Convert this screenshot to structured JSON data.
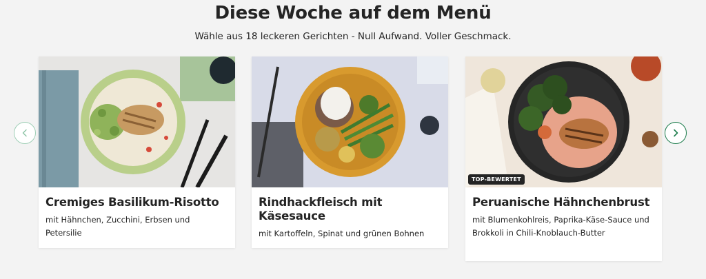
{
  "section": {
    "title": "Diese Woche auf dem Menü",
    "subtitle": "Wähle aus 18 leckeren Gerichten - Null Aufwand. Voller Geschmack."
  },
  "cards": [
    {
      "name": "Cremiges Basilikum-Risotto",
      "description": "mit Hähnchen, Zucchini, Erbsen und Petersilie",
      "badge": ""
    },
    {
      "name": "Rindhackfleisch mit Käsesauce",
      "description": "mit Kartoffeln, Spinat und grünen Bohnen",
      "badge": ""
    },
    {
      "name": "Peruanische Hähnchenbrust",
      "description": "mit Blumenkohlreis, Paprika-Käse-Sauce und Brokkoli in Chili-Knoblauch-Butter",
      "badge": "TOP-BEWERTET"
    }
  ],
  "navigation": {
    "prev_icon": "chevron-left-icon",
    "next_icon": "chevron-right-icon"
  },
  "colors": {
    "background": "#f3f3f3",
    "accent_green": "#1b7c4b",
    "text": "#242424"
  }
}
